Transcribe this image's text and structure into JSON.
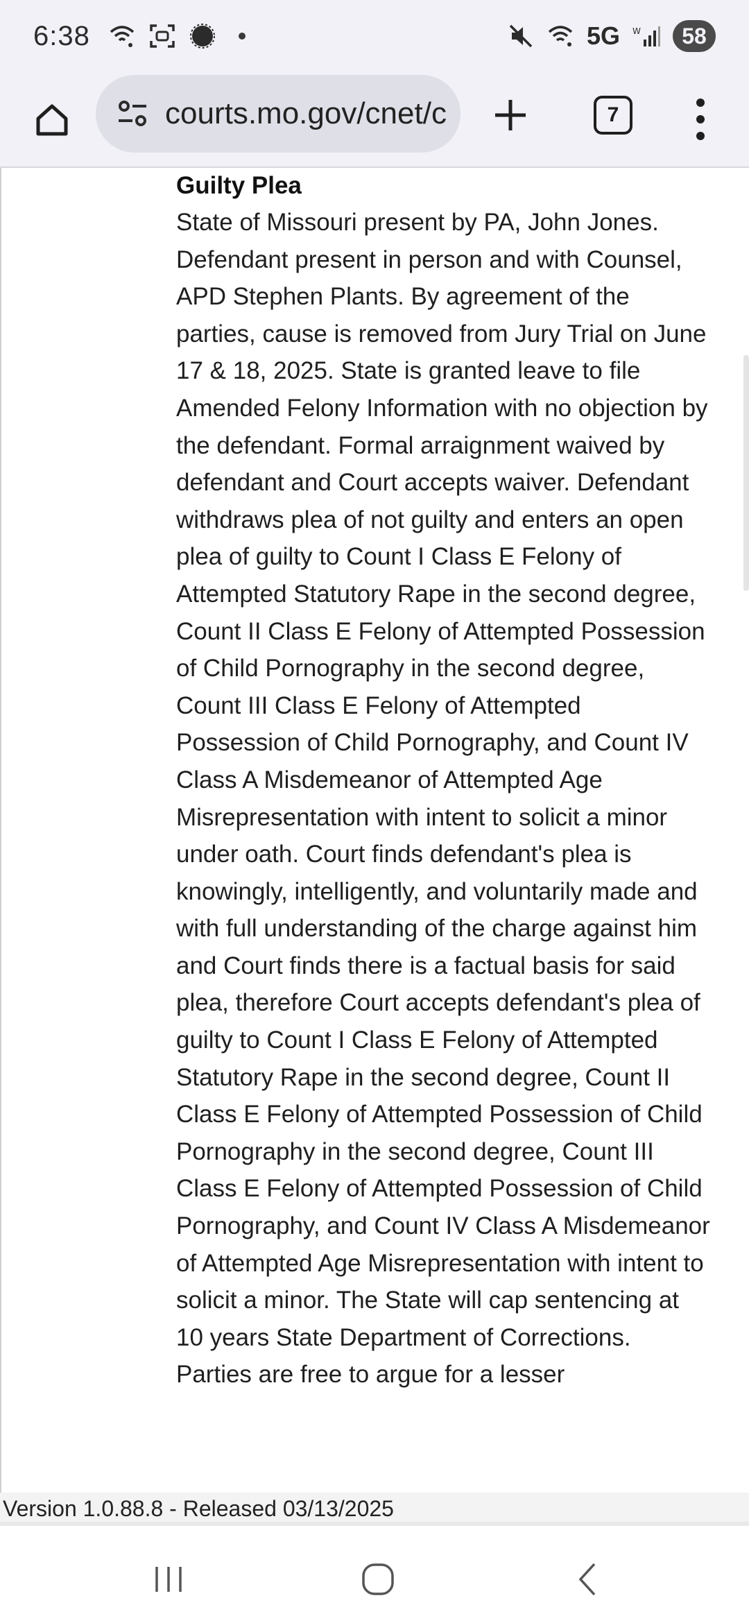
{
  "status_bar": {
    "time": "6:38",
    "network": "5G",
    "battery": "58",
    "icons": [
      "wifi-call-icon",
      "screenshot-icon",
      "app-icon",
      "mute-icon",
      "wifi-icon",
      "signal-icon"
    ]
  },
  "browser": {
    "url": "courts.mo.gov/cnet/c",
    "tab_count": "7",
    "accent": "#f1f1f7"
  },
  "entry": {
    "title": "Guilty Plea",
    "body": "State of Missouri present by PA, John Jones. Defendant present in person and with Counsel, APD Stephen Plants. By agreement of the parties, cause is removed from Jury Trial on June 17 & 18, 2025. State is granted leave to file Amended Felony Information with no objection by the defendant. Formal arraignment waived by defendant and Court accepts waiver. Defendant withdraws plea of not guilty and enters an open plea of guilty to Count I Class E Felony of Attempted Statutory Rape in the second degree, Count II Class E Felony of Attempted Possession of Child Pornography in the second degree, Count III Class E Felony of Attempted Possession of Child Pornography, and Count IV Class A Misdemeanor of Attempted Age Misrepresentation with intent to solicit a minor under oath. Court finds defendant's plea is knowingly, intelligently, and voluntarily made and with full understanding of the charge against him and Court finds there is a factual basis for said plea, therefore Court accepts defendant's plea of guilty to Count I Class E Felony of Attempted Statutory Rape in the second degree, Count II Class E Felony of Attempted Possession of Child Pornography in the second degree, Count III Class E Felony of Attempted Possession of Child Pornography, and Count IV Class A Misdemeanor of Attempted Age Misrepresentation with intent to solicit a minor. The State will cap sentencing at 10 years State Department of Corrections. Parties are free to argue for a lesser"
  },
  "footer": {
    "version": "Version 1.0.88.8 - Released 03/13/2025"
  }
}
